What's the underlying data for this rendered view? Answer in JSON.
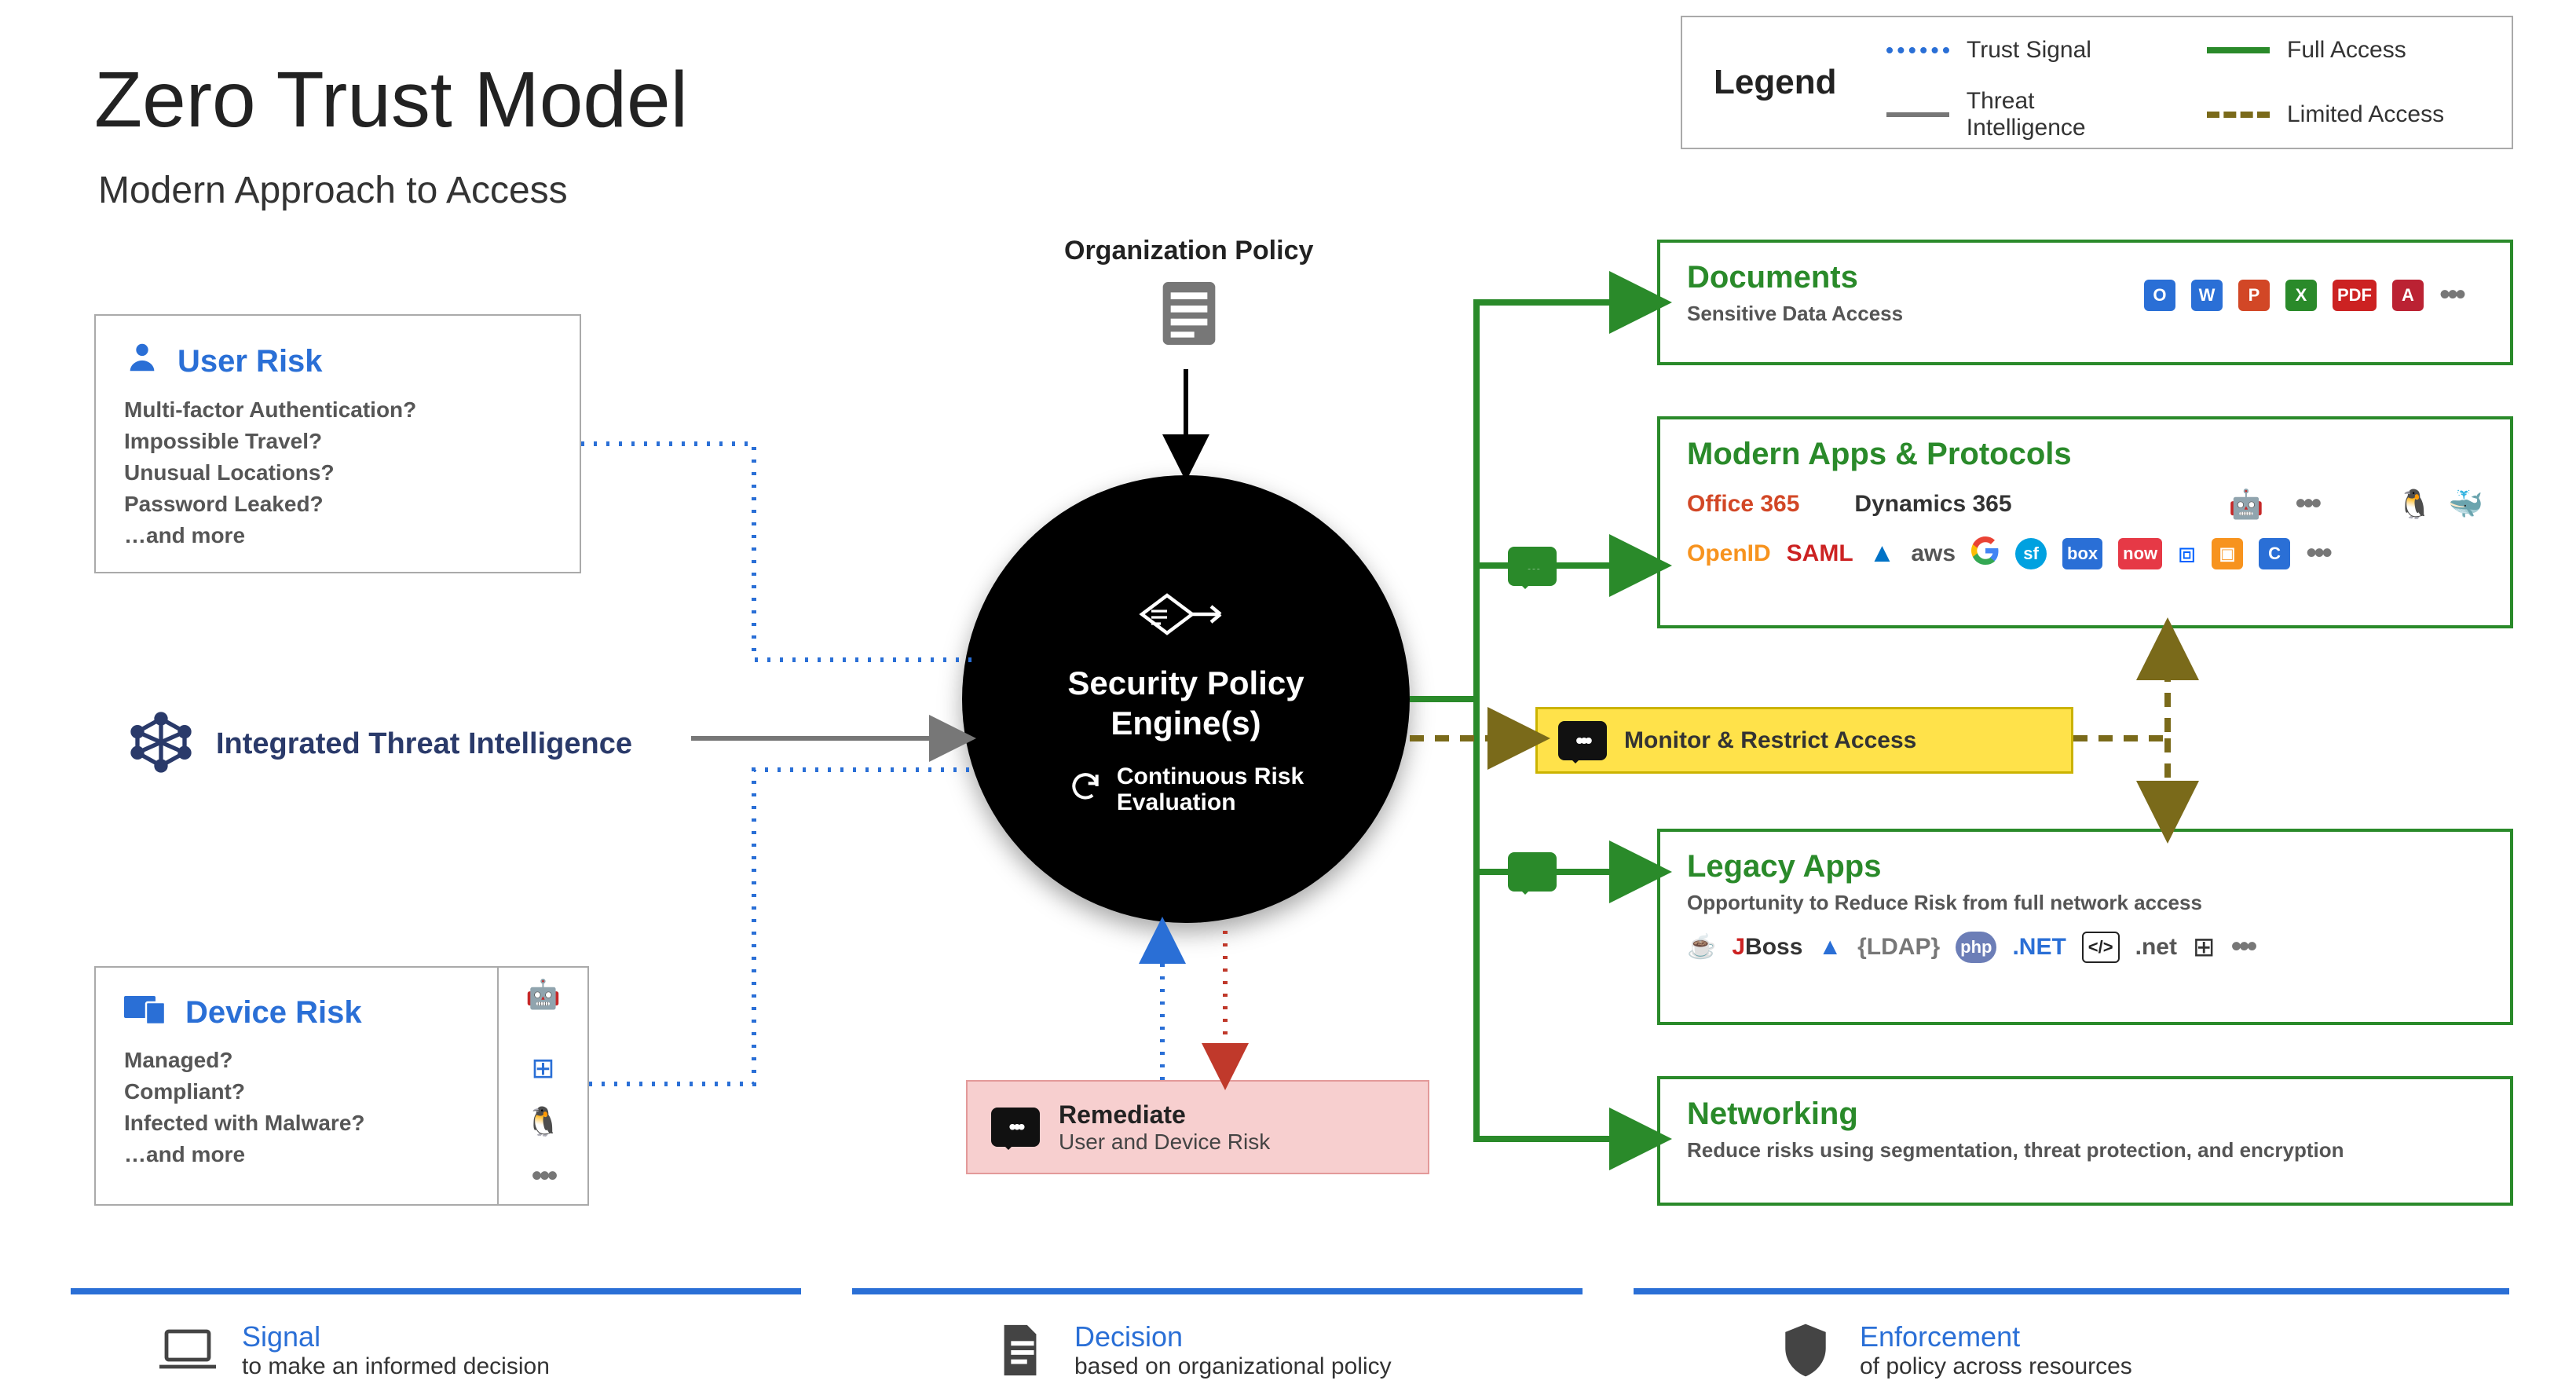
{
  "title": "Zero Trust Model",
  "subtitle": "Modern Approach to Access",
  "legend": {
    "title": "Legend",
    "trust": "Trust Signal",
    "threat": "Threat Intelligence",
    "full": "Full Access",
    "limited": "Limited Access"
  },
  "user_risk": {
    "title": "User Risk",
    "items": [
      "Multi-factor Authentication?",
      "Impossible Travel?",
      "Unusual Locations?",
      "Password Leaked?",
      "…and more"
    ]
  },
  "threat_intel": "Integrated Threat Intelligence",
  "device_risk": {
    "title": "Device Risk",
    "items": [
      "Managed?",
      "Compliant?",
      "Infected with Malware?",
      "…and more"
    ]
  },
  "org_policy": "Organization Policy",
  "engine": {
    "title_a": "Security Policy",
    "title_b": "Engine(s)",
    "continuous": "Continuous Risk\nEvaluation"
  },
  "remediate": {
    "title": "Remediate",
    "sub": "User and Device Risk"
  },
  "monitor": "Monitor & Restrict Access",
  "resources": {
    "docs": {
      "title": "Documents",
      "sub": "Sensitive Data Access"
    },
    "modern": {
      "title": "Modern Apps & Protocols",
      "o365": "Office 365",
      "d365": "Dynamics 365"
    },
    "legacy": {
      "title": "Legacy Apps",
      "sub": "Opportunity to Reduce Risk from full network access",
      "ldap": "{LDAP}"
    },
    "network": {
      "title": "Networking",
      "sub": "Reduce risks using segmentation, threat protection, and encryption"
    }
  },
  "footer": {
    "signal": {
      "title": "Signal",
      "sub": "to make an informed decision"
    },
    "decision": {
      "title": "Decision",
      "sub": "based on organizational policy"
    },
    "enforcement": {
      "title": "Enforcement",
      "sub": "of policy across resources"
    }
  }
}
